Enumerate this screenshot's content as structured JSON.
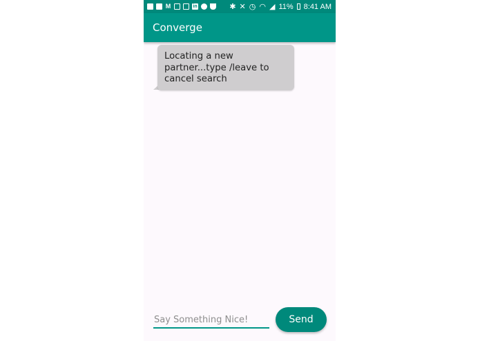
{
  "status_bar": {
    "notification_icons": [
      "clipboard-icon",
      "mail-icon",
      "gmail-icon",
      "image-icon",
      "news-icon",
      "linkedin-icon",
      "sync-icon",
      "pocket-icon"
    ],
    "system_icons": [
      "bluetooth-icon",
      "mute-icon",
      "alarm-icon",
      "wifi-icon",
      "signal-icon"
    ],
    "battery_percent": "11%",
    "time": "8:41 AM"
  },
  "app_bar": {
    "title": "Converge"
  },
  "messages": [
    {
      "text": "Locating a new partner...type /leave to cancel search"
    }
  ],
  "composer": {
    "placeholder": "Say Something Nice!",
    "value": "",
    "send_label": "Send"
  },
  "colors": {
    "primary": "#009688",
    "primary_dark": "#00897b",
    "bubble": "#cfcdcf",
    "background": "#fdf9fd"
  }
}
